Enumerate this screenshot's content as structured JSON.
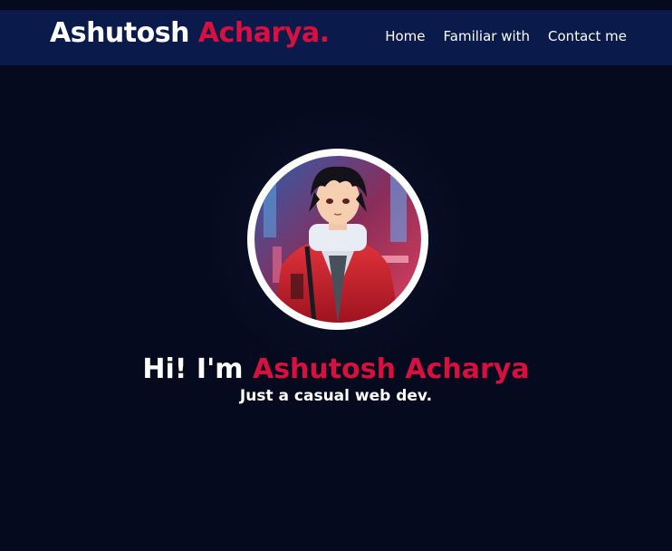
{
  "nav": {
    "brand_first": "Ashutosh",
    "brand_accent": "Acharya.",
    "links": [
      "Home",
      "Familiar with",
      "Contact me"
    ]
  },
  "hero": {
    "greeting": "Hi! I'm",
    "name": "Ashutosh Acharya",
    "tagline": "Just a casual web dev.",
    "avatar_icon": "anime-character-avatar"
  },
  "colors": {
    "background": "#050a1e",
    "navbar": "#0a1a4a",
    "accent": "#d8103f",
    "text": "#ffffff"
  }
}
